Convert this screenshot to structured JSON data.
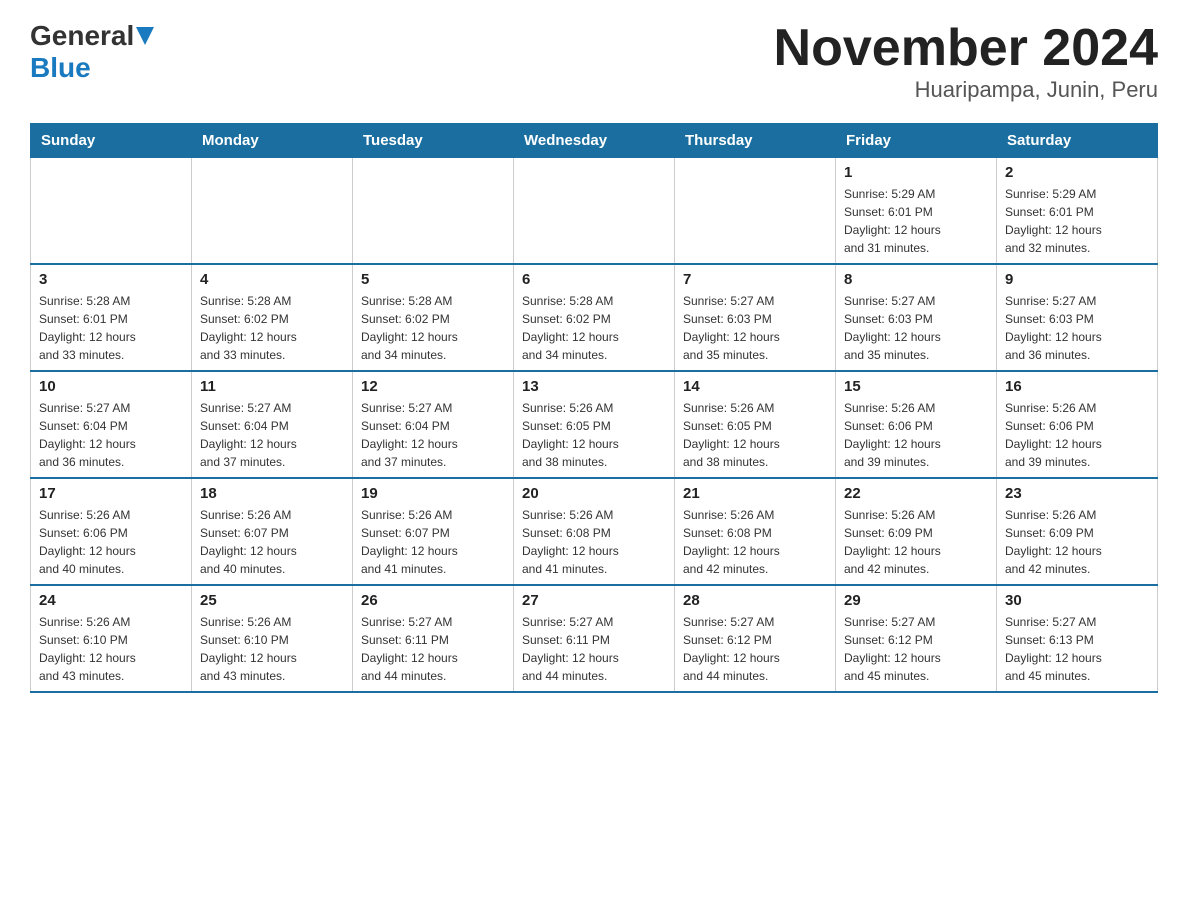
{
  "header": {
    "logo": {
      "general": "General",
      "blue": "Blue"
    },
    "title": "November 2024",
    "subtitle": "Huaripampa, Junin, Peru"
  },
  "calendar": {
    "headers": [
      "Sunday",
      "Monday",
      "Tuesday",
      "Wednesday",
      "Thursday",
      "Friday",
      "Saturday"
    ],
    "weeks": [
      {
        "days": [
          {
            "num": "",
            "info": ""
          },
          {
            "num": "",
            "info": ""
          },
          {
            "num": "",
            "info": ""
          },
          {
            "num": "",
            "info": ""
          },
          {
            "num": "",
            "info": ""
          },
          {
            "num": "1",
            "info": "Sunrise: 5:29 AM\nSunset: 6:01 PM\nDaylight: 12 hours\nand 31 minutes."
          },
          {
            "num": "2",
            "info": "Sunrise: 5:29 AM\nSunset: 6:01 PM\nDaylight: 12 hours\nand 32 minutes."
          }
        ]
      },
      {
        "days": [
          {
            "num": "3",
            "info": "Sunrise: 5:28 AM\nSunset: 6:01 PM\nDaylight: 12 hours\nand 33 minutes."
          },
          {
            "num": "4",
            "info": "Sunrise: 5:28 AM\nSunset: 6:02 PM\nDaylight: 12 hours\nand 33 minutes."
          },
          {
            "num": "5",
            "info": "Sunrise: 5:28 AM\nSunset: 6:02 PM\nDaylight: 12 hours\nand 34 minutes."
          },
          {
            "num": "6",
            "info": "Sunrise: 5:28 AM\nSunset: 6:02 PM\nDaylight: 12 hours\nand 34 minutes."
          },
          {
            "num": "7",
            "info": "Sunrise: 5:27 AM\nSunset: 6:03 PM\nDaylight: 12 hours\nand 35 minutes."
          },
          {
            "num": "8",
            "info": "Sunrise: 5:27 AM\nSunset: 6:03 PM\nDaylight: 12 hours\nand 35 minutes."
          },
          {
            "num": "9",
            "info": "Sunrise: 5:27 AM\nSunset: 6:03 PM\nDaylight: 12 hours\nand 36 minutes."
          }
        ]
      },
      {
        "days": [
          {
            "num": "10",
            "info": "Sunrise: 5:27 AM\nSunset: 6:04 PM\nDaylight: 12 hours\nand 36 minutes."
          },
          {
            "num": "11",
            "info": "Sunrise: 5:27 AM\nSunset: 6:04 PM\nDaylight: 12 hours\nand 37 minutes."
          },
          {
            "num": "12",
            "info": "Sunrise: 5:27 AM\nSunset: 6:04 PM\nDaylight: 12 hours\nand 37 minutes."
          },
          {
            "num": "13",
            "info": "Sunrise: 5:26 AM\nSunset: 6:05 PM\nDaylight: 12 hours\nand 38 minutes."
          },
          {
            "num": "14",
            "info": "Sunrise: 5:26 AM\nSunset: 6:05 PM\nDaylight: 12 hours\nand 38 minutes."
          },
          {
            "num": "15",
            "info": "Sunrise: 5:26 AM\nSunset: 6:06 PM\nDaylight: 12 hours\nand 39 minutes."
          },
          {
            "num": "16",
            "info": "Sunrise: 5:26 AM\nSunset: 6:06 PM\nDaylight: 12 hours\nand 39 minutes."
          }
        ]
      },
      {
        "days": [
          {
            "num": "17",
            "info": "Sunrise: 5:26 AM\nSunset: 6:06 PM\nDaylight: 12 hours\nand 40 minutes."
          },
          {
            "num": "18",
            "info": "Sunrise: 5:26 AM\nSunset: 6:07 PM\nDaylight: 12 hours\nand 40 minutes."
          },
          {
            "num": "19",
            "info": "Sunrise: 5:26 AM\nSunset: 6:07 PM\nDaylight: 12 hours\nand 41 minutes."
          },
          {
            "num": "20",
            "info": "Sunrise: 5:26 AM\nSunset: 6:08 PM\nDaylight: 12 hours\nand 41 minutes."
          },
          {
            "num": "21",
            "info": "Sunrise: 5:26 AM\nSunset: 6:08 PM\nDaylight: 12 hours\nand 42 minutes."
          },
          {
            "num": "22",
            "info": "Sunrise: 5:26 AM\nSunset: 6:09 PM\nDaylight: 12 hours\nand 42 minutes."
          },
          {
            "num": "23",
            "info": "Sunrise: 5:26 AM\nSunset: 6:09 PM\nDaylight: 12 hours\nand 42 minutes."
          }
        ]
      },
      {
        "days": [
          {
            "num": "24",
            "info": "Sunrise: 5:26 AM\nSunset: 6:10 PM\nDaylight: 12 hours\nand 43 minutes."
          },
          {
            "num": "25",
            "info": "Sunrise: 5:26 AM\nSunset: 6:10 PM\nDaylight: 12 hours\nand 43 minutes."
          },
          {
            "num": "26",
            "info": "Sunrise: 5:27 AM\nSunset: 6:11 PM\nDaylight: 12 hours\nand 44 minutes."
          },
          {
            "num": "27",
            "info": "Sunrise: 5:27 AM\nSunset: 6:11 PM\nDaylight: 12 hours\nand 44 minutes."
          },
          {
            "num": "28",
            "info": "Sunrise: 5:27 AM\nSunset: 6:12 PM\nDaylight: 12 hours\nand 44 minutes."
          },
          {
            "num": "29",
            "info": "Sunrise: 5:27 AM\nSunset: 6:12 PM\nDaylight: 12 hours\nand 45 minutes."
          },
          {
            "num": "30",
            "info": "Sunrise: 5:27 AM\nSunset: 6:13 PM\nDaylight: 12 hours\nand 45 minutes."
          }
        ]
      }
    ]
  }
}
